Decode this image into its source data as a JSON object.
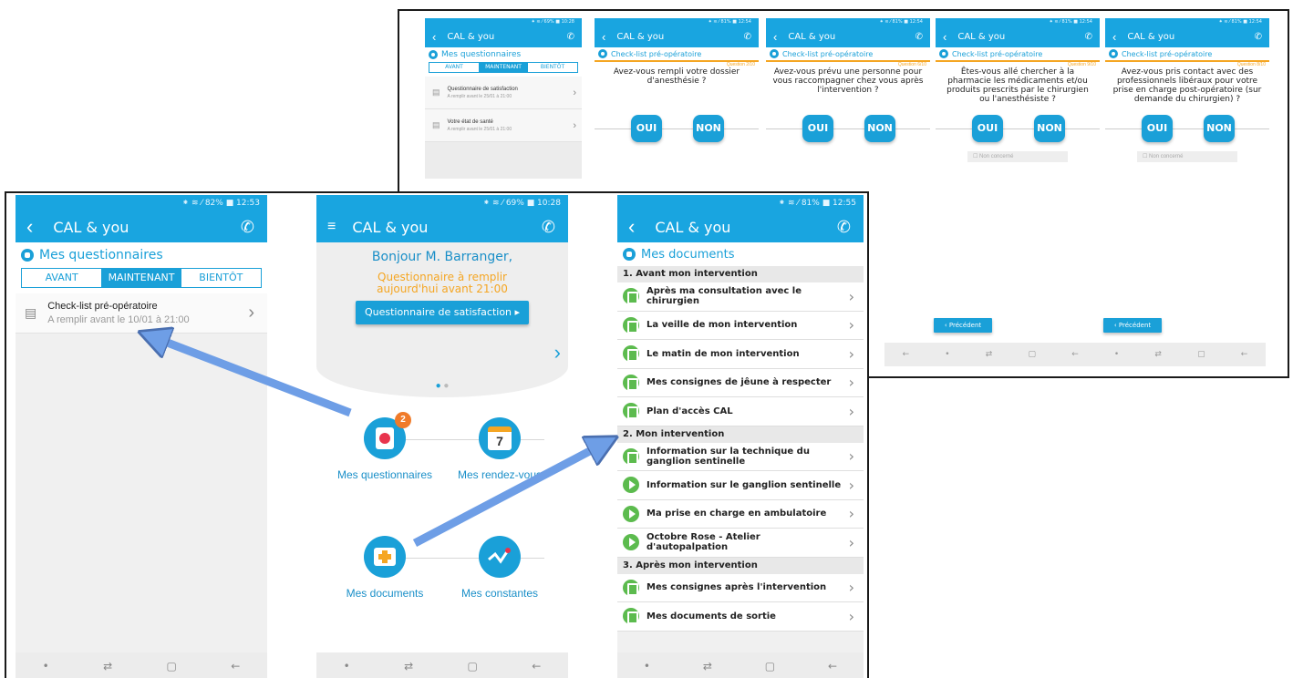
{
  "colors": {
    "primary": "#19a5e0",
    "accent_orange": "#f5a623",
    "doc_green": "#5cbb4e",
    "arrow": "#6e9ee6"
  },
  "app": {
    "title": "CAL & you"
  },
  "nav_icons": [
    "home-dot-icon",
    "recent-apps-icon",
    "overview-icon",
    "back-icon"
  ],
  "nav_glyphs": {
    "dot": "•",
    "recent": "⇄",
    "square": "▢",
    "back": "←"
  },
  "top_composite": {
    "p1": {
      "status": "⁕ ≋ ⁄ 69% ■ 10:28",
      "section": "Mes questionnaires",
      "tabs": [
        "AVANT",
        "MAINTENANT",
        "BIENTÔT"
      ],
      "items": [
        {
          "title": "Questionnaire de satisfaction",
          "sub": "A remplir avant le 25/01 à 21:00"
        },
        {
          "title": "Votre état de santé",
          "sub": "A remplir avant le 25/01 à 21:00"
        }
      ]
    },
    "questions": [
      {
        "status": "⁕ ≋ ⁄ 81% ■ 12:54",
        "num": "Question 2/10",
        "text": "Avez-vous rempli votre dossier d'anesthésie ?",
        "non_concerne": false
      },
      {
        "status": "⁕ ≋ ⁄ 81% ■ 12:54",
        "num": "Question 6/10",
        "text": "Avez-vous prévu une personne pour vous raccompagner chez vous après l'intervention ?",
        "non_concerne": false
      },
      {
        "status": "⁕ ≋ ⁄ 81% ■ 12:54",
        "num": "Question 9/10",
        "text": "Êtes-vous allé chercher à la pharmacie les médicaments et/ou produits prescrits par le chirurgien ou l'anesthésiste ?",
        "non_concerne": true
      },
      {
        "status": "⁕ ≋ ⁄ 81% ■ 12:54",
        "num": "Question 8/10",
        "text": "Avez-vous pris contact avec des professionnels libéraux pour votre prise en charge post-opératoire (sur demande du chirurgien) ?",
        "non_concerne": true
      }
    ],
    "checklist_title": "Check-list pré-opératoire",
    "oui": "OUI",
    "non": "NON",
    "non_concerne_label": "Non concerné",
    "precedent": "Précédent"
  },
  "left_phone": {
    "status": "⁕ ≋ ⁄ 82% ■ 12:53",
    "section": "Mes questionnaires",
    "tabs": [
      "AVANT",
      "MAINTENANT",
      "BIENTÔT"
    ],
    "item": {
      "title": "Check-list pré-opératoire",
      "sub": "A remplir avant le 10/01 à 21:00"
    }
  },
  "middle_phone": {
    "status": "⁕ ≋ ⁄ 69% ■ 10:28",
    "greeting": "Bonjour M. Barranger,",
    "todo": "Questionnaire à remplir aujourd'hui avant 21:00",
    "cta": "Questionnaire de satisfaction ▸",
    "badge": "2",
    "calendar_day": "7",
    "tiles": [
      "Mes questionnaires",
      "Mes rendez-vous",
      "Mes documents",
      "Mes constantes"
    ]
  },
  "right_phone": {
    "status": "⁕ ≋ ⁄ 81% ■ 12:55",
    "section": "Mes documents",
    "groups": [
      {
        "head": "1. Avant mon intervention",
        "rows": [
          {
            "label": "Après ma consultation avec le chirurgien",
            "icon": "doc"
          },
          {
            "label": "La veille de mon intervention",
            "icon": "doc"
          },
          {
            "label": "Le matin de mon intervention",
            "icon": "doc"
          },
          {
            "label": "Mes consignes de jêune à respecter",
            "icon": "doc"
          },
          {
            "label": "Plan d'accès CAL",
            "icon": "doc"
          }
        ]
      },
      {
        "head": "2. Mon intervention",
        "rows": [
          {
            "label": "Information sur la technique du ganglion sentinelle",
            "icon": "doc"
          },
          {
            "label": "Information sur le ganglion sentinelle",
            "icon": "play"
          },
          {
            "label": "Ma prise en charge en ambulatoire",
            "icon": "play"
          },
          {
            "label": "Octobre Rose - Atelier d'autopalpation",
            "icon": "play"
          }
        ]
      },
      {
        "head": "3. Après mon intervention",
        "rows": [
          {
            "label": "Mes consignes après l'intervention",
            "icon": "doc"
          },
          {
            "label": "Mes documents de sortie",
            "icon": "doc"
          }
        ]
      }
    ]
  }
}
